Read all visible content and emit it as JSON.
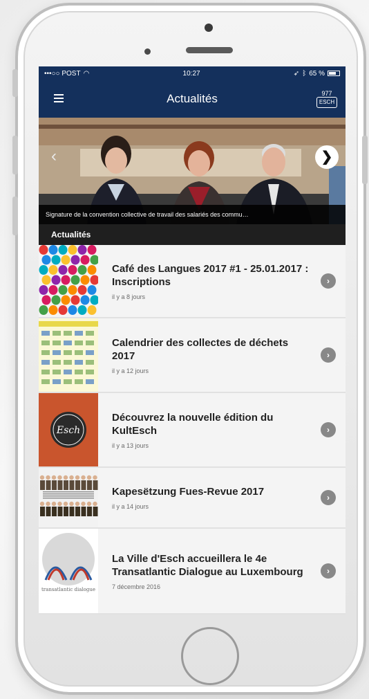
{
  "status_bar": {
    "carrier": "•••○○ POST",
    "time": "10:27",
    "battery": "65 %"
  },
  "nav": {
    "title": "Actualités",
    "logo_top": "977",
    "logo_text": "ESCH"
  },
  "hero": {
    "caption": "Signature de la convention collective de travail des salariés des commu…",
    "prev_icon": "‹",
    "next_icon": "❯"
  },
  "section": {
    "title": "Actualités"
  },
  "news": [
    {
      "title": "Café des Langues 2017 #1 - 25.01.2017 : Inscriptions",
      "date": "il y a 8 jours",
      "thumb": "colored-balls"
    },
    {
      "title": "Calendrier des collectes de déchets 2017",
      "date": "il y a 12 jours",
      "thumb": "calendar"
    },
    {
      "title": "Découvrez la nouvelle édition du KultEsch",
      "date": "il y a 13 jours",
      "thumb": "kultesch"
    },
    {
      "title": "Kapesëtzung Fues-Revue 2017",
      "date": "il y a 14 jours",
      "thumb": "group-photo"
    },
    {
      "title": "La Ville d'Esch accueillera le 4e Transatlantic Dialogue au Luxembourg",
      "date": "7 décembre 2016",
      "thumb": "transatlantic-dialogue",
      "thumb_text": "transatlantic dialogue"
    }
  ],
  "colors": {
    "navbar": "#14305c",
    "section_header": "#1f1f1f",
    "list_bg": "#f4f4f4",
    "kultesch_orange": "#c9552d"
  },
  "chevron_icon": "›"
}
